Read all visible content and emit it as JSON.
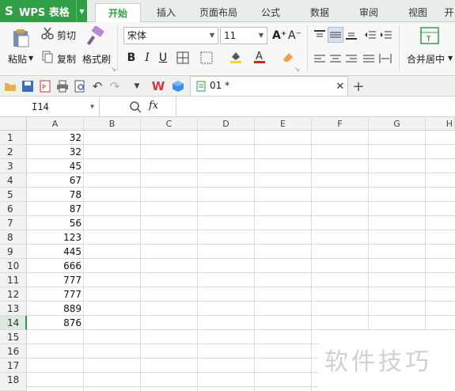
{
  "app": {
    "name": "WPS 表格"
  },
  "tabs": [
    "开始",
    "插入",
    "页面布局",
    "公式",
    "数据",
    "审阅",
    "视图",
    "开"
  ],
  "ribbon": {
    "paste": "粘贴",
    "cut": "剪切",
    "copy": "复制",
    "format_painter": "格式刷",
    "font_name": "宋体",
    "font_size": "11",
    "merge_center": "合并居中"
  },
  "document": {
    "tab_title": "01 *"
  },
  "formula_bar": {
    "cell_ref": "I14",
    "fx": "fx"
  },
  "sheet": {
    "columns": [
      "A",
      "B",
      "C",
      "D",
      "E",
      "F",
      "G",
      "H"
    ],
    "rows": [
      "1",
      "2",
      "3",
      "4",
      "5",
      "6",
      "7",
      "8",
      "9",
      "10",
      "11",
      "12",
      "13",
      "14",
      "15",
      "16",
      "17",
      "18"
    ],
    "col_a_values": [
      "32",
      "32",
      "45",
      "67",
      "78",
      "87",
      "56",
      "123",
      "445",
      "666",
      "777",
      "777",
      "889",
      "876"
    ],
    "selected_row": "14"
  },
  "watermark": "软件技巧"
}
